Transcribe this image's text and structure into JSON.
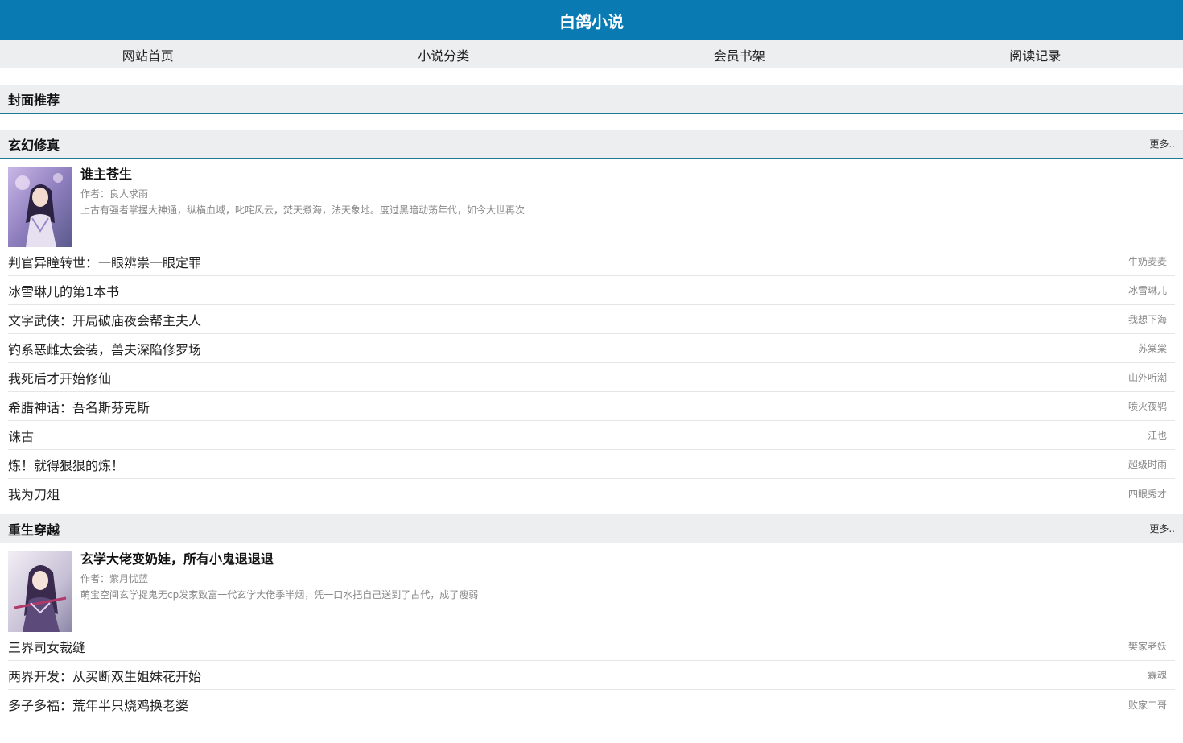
{
  "site": {
    "title": "白鸽小说"
  },
  "nav": [
    {
      "label": "网站首页"
    },
    {
      "label": "小说分类"
    },
    {
      "label": "会员书架"
    },
    {
      "label": "阅读记录"
    }
  ],
  "cover_section": {
    "title": "封面推荐"
  },
  "sections": [
    {
      "title": "玄幻修真",
      "more": "更多..",
      "featured": {
        "title": "谁主苍生",
        "author": "作者：良人求雨",
        "desc": "上古有强者掌握大神通，纵横血域，叱咤风云，焚天煮海，法天象地。度过黑暗动荡年代，如今大世再次"
      },
      "books": [
        {
          "name": "判官异瞳转世：一眼辨祟一眼定罪",
          "author": "牛奶麦麦"
        },
        {
          "name": "冰雪琳儿的第1本书",
          "author": "冰雪琳儿"
        },
        {
          "name": "文字武侠：开局破庙夜会帮主夫人",
          "author": "我想下海"
        },
        {
          "name": "钓系恶雌太会装，兽夫深陷修罗场",
          "author": "苏棠棠"
        },
        {
          "name": "我死后才开始修仙",
          "author": "山外听潮"
        },
        {
          "name": "希腊神话：吾名斯芬克斯",
          "author": "喷火夜鸮"
        },
        {
          "name": "诛古",
          "author": "江也"
        },
        {
          "name": "炼！就得狠狠的炼！",
          "author": "超级时雨"
        },
        {
          "name": "我为刀俎",
          "author": "四眼秀才"
        }
      ]
    },
    {
      "title": "重生穿越",
      "more": "更多..",
      "featured": {
        "title": "玄学大佬变奶娃，所有小鬼退退退",
        "author": "作者：紫月忧蓝",
        "desc": "萌宝空间玄学捉鬼无cp发家致富一代玄学大佬季半烟，凭一口水把自己送到了古代，成了瘦弱"
      },
      "books": [
        {
          "name": "三界司女裁缝",
          "author": "樊家老妖"
        },
        {
          "name": "两界开发：从买断双生姐妹花开始",
          "author": "霖魂"
        },
        {
          "name": "多子多福：荒年半只烧鸡换老婆",
          "author": "败家二哥"
        }
      ]
    }
  ],
  "colors": {
    "header": "#0a7ab3",
    "nav_bg": "#eceeef",
    "section_border": "#1e7c92"
  }
}
